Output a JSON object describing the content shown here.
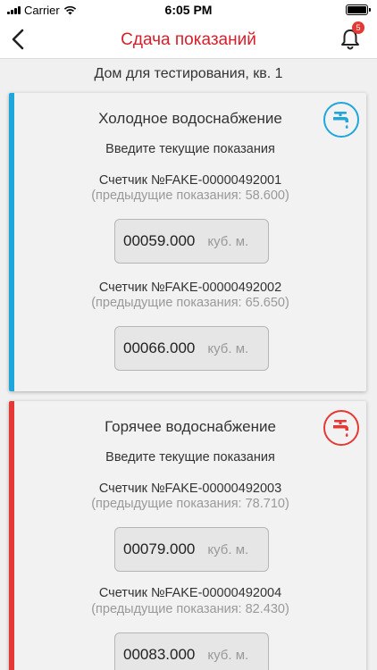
{
  "status": {
    "carrier": "Carrier",
    "time": "6:05 PM"
  },
  "nav": {
    "title": "Сдача показаний",
    "badge": "5"
  },
  "address": "Дом для тестирования, кв. 1",
  "hint": "Введите текущие показания",
  "unit": "куб. м.",
  "colors": {
    "cold": "#1fa7dc",
    "hot": "#e53935",
    "title": "#d81e2a"
  },
  "cards": [
    {
      "title": "Холодное водоснабжение",
      "icon": "cold-water-tap-icon",
      "meters": [
        {
          "name": "Счетчик №FAKE-00000492001",
          "previous": "(предыдущие показания: 58.600)",
          "value": "00059.000"
        },
        {
          "name": "Счетчик №FAKE-00000492002",
          "previous": "(предыдущие показания: 65.650)",
          "value": "00066.000"
        }
      ]
    },
    {
      "title": "Горячее водоснабжение",
      "icon": "hot-water-tap-icon",
      "meters": [
        {
          "name": "Счетчик №FAKE-00000492003",
          "previous": "(предыдущие показания: 78.710)",
          "value": "00079.000"
        },
        {
          "name": "Счетчик №FAKE-00000492004",
          "previous": "(предыдущие показания: 82.430)",
          "value": "00083.000"
        }
      ]
    }
  ]
}
